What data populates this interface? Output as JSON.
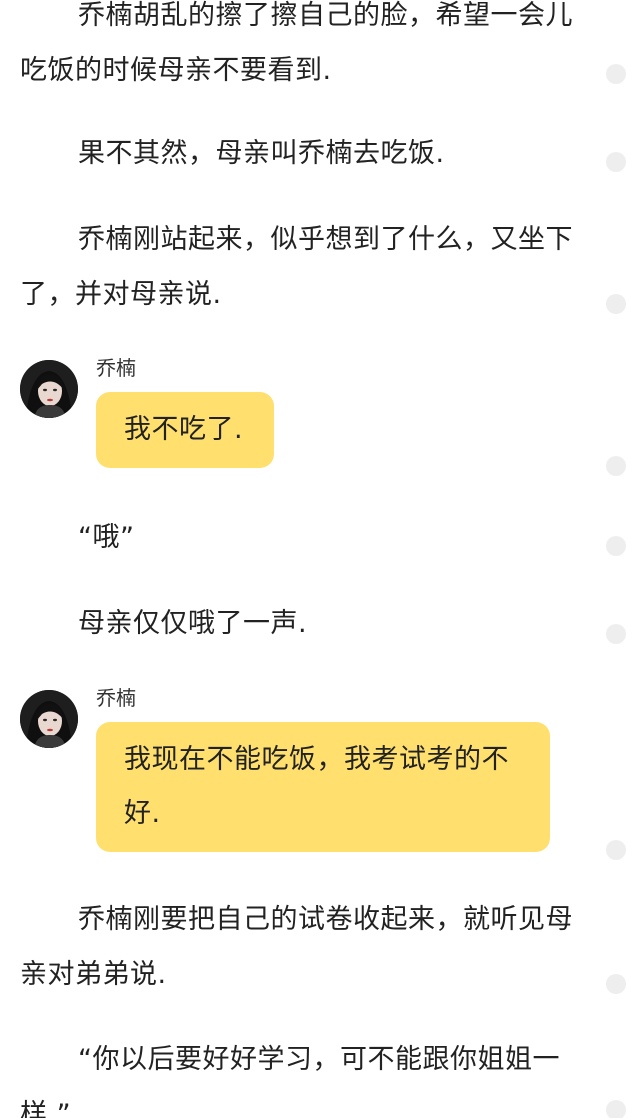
{
  "paragraphs": [
    "乔楠胡乱的擦了擦自己的脸，希望一会儿吃饭的时候母亲不要看到.",
    "果不其然，母亲叫乔楠去吃饭.",
    "乔楠刚站起来，似乎想到了什么，又坐下了，并对母亲说.",
    "“哦”",
    "母亲仅仅哦了一声.",
    "乔楠刚要把自己的试卷收起来，就听见母亲对弟弟说.",
    "“你以后要好好学习，可不能跟你姐姐一样.”"
  ],
  "dialogs": [
    {
      "speaker": "乔楠",
      "message": "我不吃了."
    },
    {
      "speaker": "乔楠",
      "message": "我现在不能吃饭，我考试考的不好."
    }
  ],
  "colors": {
    "bubble": "#ffe06e",
    "text": "#222222",
    "dot": "#eeeeee"
  }
}
